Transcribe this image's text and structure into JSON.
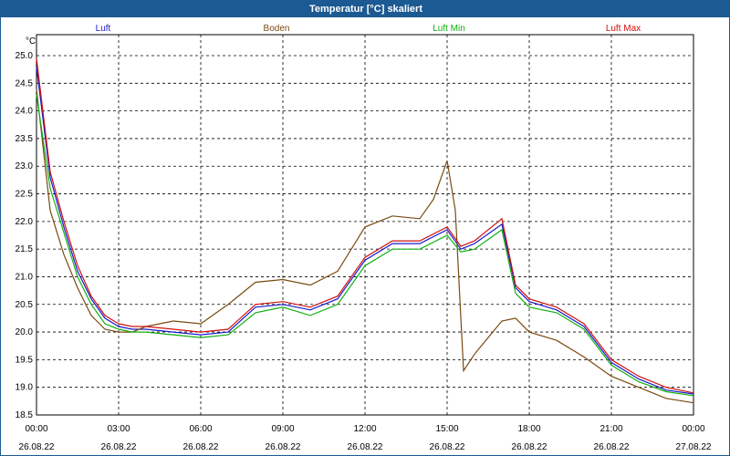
{
  "window": {
    "title": "Temperatur [°C] skaliert"
  },
  "chart_data": {
    "type": "line",
    "title": "Temperatur [°C] skaliert",
    "y_unit": "°C",
    "ylim": [
      18.5,
      25.0
    ],
    "y_ticks": [
      "25.0",
      "24.5",
      "24.0",
      "23.5",
      "23.0",
      "22.5",
      "22.0",
      "21.5",
      "21.0",
      "20.5",
      "20.0",
      "19.5",
      "19.0",
      "18.5"
    ],
    "x_range_hours": [
      0,
      24
    ],
    "x_ticks": [
      {
        "time": "00:00",
        "date": "26.08.22"
      },
      {
        "time": "03:00",
        "date": "26.08.22"
      },
      {
        "time": "06:00",
        "date": "26.08.22"
      },
      {
        "time": "09:00",
        "date": "26.08.22"
      },
      {
        "time": "12:00",
        "date": "26.08.22"
      },
      {
        "time": "15:00",
        "date": "26.08.22"
      },
      {
        "time": "18:00",
        "date": "26.08.22"
      },
      {
        "time": "21:00",
        "date": "26.08.22"
      },
      {
        "time": "00:00",
        "date": "27.08.22"
      }
    ],
    "grid": true,
    "legend_position": "top",
    "series": [
      {
        "name": "Luft",
        "color": "#1a1acc",
        "x": [
          0,
          0.5,
          1,
          1.5,
          2,
          2.5,
          3,
          3.5,
          4,
          5,
          6,
          7,
          8,
          9,
          10,
          11,
          12,
          13,
          14,
          15,
          15.5,
          16,
          17,
          17.5,
          18,
          19,
          20,
          21,
          22,
          23,
          24
        ],
        "y": [
          24.8,
          22.8,
          21.9,
          21.1,
          20.6,
          20.25,
          20.1,
          20.05,
          20.05,
          20.0,
          19.95,
          20.0,
          20.45,
          20.5,
          20.4,
          20.6,
          21.3,
          21.6,
          21.6,
          21.85,
          21.5,
          21.6,
          21.95,
          20.8,
          20.55,
          20.4,
          20.1,
          19.45,
          19.15,
          18.95,
          18.88
        ]
      },
      {
        "name": "Boden",
        "color": "#7a4a10",
        "x": [
          0,
          0.5,
          1,
          1.5,
          2,
          2.5,
          3,
          3.5,
          4,
          5,
          6,
          7,
          8,
          9,
          10,
          11,
          12,
          13,
          14,
          14.5,
          15,
          15.3,
          15.6,
          16,
          17,
          17.5,
          18,
          19,
          20,
          21,
          22,
          23,
          24
        ],
        "y": [
          24.4,
          22.2,
          21.4,
          20.8,
          20.3,
          20.05,
          20.0,
          20.0,
          20.1,
          20.2,
          20.15,
          20.5,
          20.9,
          20.95,
          20.85,
          21.1,
          21.9,
          22.1,
          22.05,
          22.4,
          23.1,
          22.2,
          19.3,
          19.6,
          20.2,
          20.25,
          20.0,
          19.85,
          19.55,
          19.2,
          19.0,
          18.8,
          18.72
        ]
      },
      {
        "name": "Luft Min",
        "color": "#10b010",
        "x": [
          0,
          0.5,
          1,
          1.5,
          2,
          2.5,
          3,
          3.5,
          4,
          5,
          6,
          7,
          8,
          9,
          10,
          11,
          12,
          13,
          14,
          15,
          15.5,
          16,
          17,
          17.5,
          18,
          19,
          20,
          21,
          22,
          23,
          24
        ],
        "y": [
          24.3,
          22.6,
          21.8,
          21.0,
          20.5,
          20.15,
          20.05,
          20.0,
          20.0,
          19.95,
          19.9,
          19.95,
          20.35,
          20.45,
          20.3,
          20.5,
          21.2,
          21.5,
          21.5,
          21.75,
          21.45,
          21.5,
          21.85,
          20.7,
          20.45,
          20.35,
          20.05,
          19.4,
          19.1,
          18.92,
          18.85
        ]
      },
      {
        "name": "Luft Max",
        "color": "#d01010",
        "x": [
          0,
          0.5,
          1,
          1.5,
          2,
          2.5,
          3,
          3.5,
          4,
          5,
          6,
          7,
          8,
          9,
          10,
          11,
          12,
          13,
          14,
          15,
          15.5,
          16,
          17,
          17.5,
          18,
          19,
          20,
          21,
          22,
          23,
          24
        ],
        "y": [
          24.95,
          22.9,
          22.0,
          21.2,
          20.65,
          20.3,
          20.15,
          20.1,
          20.1,
          20.05,
          20.0,
          20.05,
          20.5,
          20.55,
          20.45,
          20.65,
          21.35,
          21.65,
          21.65,
          21.9,
          21.55,
          21.65,
          22.05,
          20.85,
          20.6,
          20.45,
          20.15,
          19.5,
          19.2,
          19.0,
          18.9
        ]
      }
    ]
  }
}
